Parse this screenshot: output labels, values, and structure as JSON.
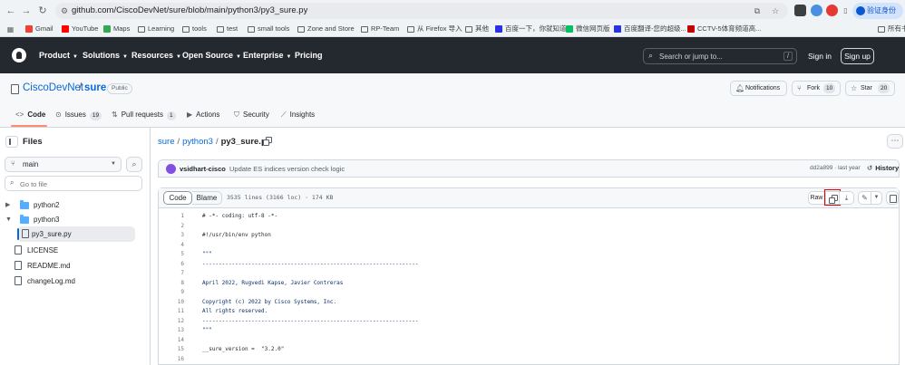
{
  "browser": {
    "url": "github.com/CiscoDevNet/sure/blob/main/python3/py3_sure.py",
    "profile_label": "验证身份",
    "bookmarks": [
      {
        "label": "Gmail",
        "color": "#ea4335"
      },
      {
        "label": "YouTube",
        "color": "#ff0000"
      },
      {
        "label": "Maps",
        "color": "#34a853"
      },
      {
        "label": "Learning",
        "color": "folder"
      },
      {
        "label": "tools",
        "color": "folder"
      },
      {
        "label": "test",
        "color": "folder"
      },
      {
        "label": "small tools",
        "color": "folder"
      },
      {
        "label": "Zone and Store",
        "color": "folder"
      },
      {
        "label": "RP-Team",
        "color": "folder"
      },
      {
        "label": "从 Firefox 导入",
        "color": "folder"
      },
      {
        "label": "其他",
        "color": "folder"
      },
      {
        "label": "百度一下，你就知道",
        "color": "#2932e1"
      },
      {
        "label": "微信网页版",
        "color": "#07c160"
      },
      {
        "label": "百度翻译-您的超级...",
        "color": "#2932e1"
      },
      {
        "label": "CCTV-5体育频道高...",
        "color": "#c00000"
      },
      {
        "label": "所有书签",
        "color": "folder"
      }
    ]
  },
  "gh_header": {
    "nav": [
      "Product",
      "Solutions",
      "Resources",
      "Open Source",
      "Enterprise",
      "Pricing"
    ],
    "search_placeholder": "Search or jump to...",
    "search_kbd": "/",
    "sign_in": "Sign in",
    "sign_up": "Sign up"
  },
  "repo": {
    "owner": "CiscoDevNet",
    "slash": "/",
    "name": "sure",
    "visibility": "Public",
    "notifications": "Notifications",
    "fork_label": "Fork",
    "fork_count": "10",
    "star_label": "Star",
    "star_count": "20",
    "tabs": {
      "code": "Code",
      "issues": "Issues",
      "issues_count": "19",
      "pulls": "Pull requests",
      "pulls_count": "1",
      "actions": "Actions",
      "security": "Security",
      "insights": "Insights"
    }
  },
  "sidebar": {
    "title": "Files",
    "branch": "main",
    "goto_placeholder": "Go to file",
    "tree": [
      {
        "label": "python2",
        "type": "folder",
        "expanded": false
      },
      {
        "label": "python3",
        "type": "folder",
        "expanded": true
      },
      {
        "label": "py3_sure.py",
        "type": "file",
        "active": true
      },
      {
        "label": "LICENSE",
        "type": "file"
      },
      {
        "label": "README.md",
        "type": "file"
      },
      {
        "label": "changeLog.md",
        "type": "file"
      }
    ]
  },
  "file": {
    "breadcrumb_repo": "sure",
    "breadcrumb_dir": "python3",
    "breadcrumb_file": "py3_sure.py",
    "sep": "/",
    "commit_author": "vsidhart-cisco",
    "commit_message": "Update ES indices version check logic",
    "commit_sha": "dd2a899",
    "commit_time": "last year",
    "history": "History",
    "view_code": "Code",
    "view_blame": "Blame",
    "info": "3535 lines (3166 loc) · 174 KB",
    "raw": "Raw"
  },
  "code_lines": [
    {
      "n": "1",
      "text": "# -*- coding: utf-8 -*-"
    },
    {
      "n": "2",
      "text": ""
    },
    {
      "n": "3",
      "text": "#!/usr/bin/env python"
    },
    {
      "n": "4",
      "text": ""
    },
    {
      "n": "5",
      "text": "\"\"\""
    },
    {
      "n": "6",
      "text": "------------------------------------------------------------------"
    },
    {
      "n": "7",
      "text": ""
    },
    {
      "n": "8",
      "text": "April 2022, Rugvedi Kapse, Javier Contreras"
    },
    {
      "n": "9",
      "text": ""
    },
    {
      "n": "10",
      "text": "Copyright (c) 2022 by Cisco Systems, Inc."
    },
    {
      "n": "11",
      "text": "All rights reserved."
    },
    {
      "n": "12",
      "text": "------------------------------------------------------------------"
    },
    {
      "n": "13",
      "text": "\"\"\""
    },
    {
      "n": "14",
      "text": ""
    },
    {
      "n": "15",
      "text": "__sure_version =  \"3.2.0\""
    },
    {
      "n": "16",
      "text": ""
    }
  ]
}
